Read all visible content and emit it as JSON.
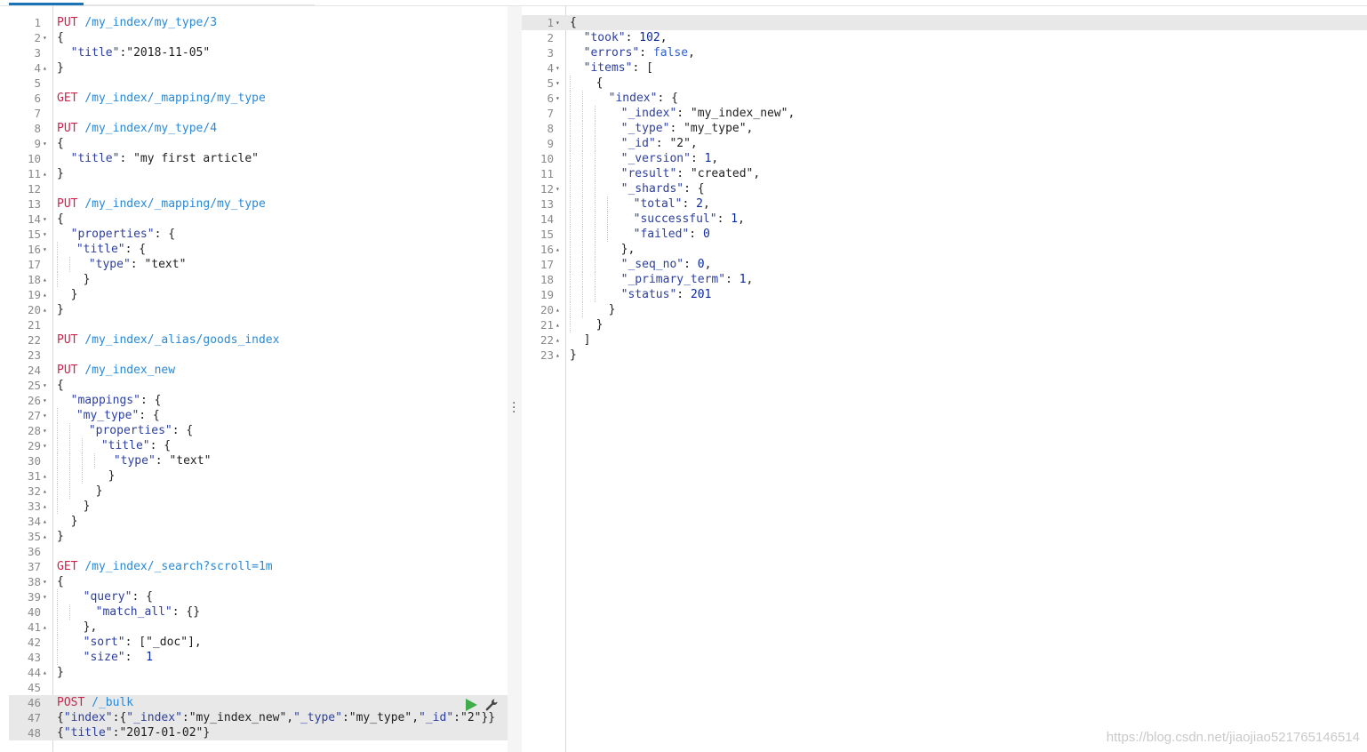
{
  "request_lines": [
    {
      "n": "1",
      "f": "",
      "p": [
        [
          "m",
          "PUT "
        ],
        [
          "u",
          "/my_index/my_type/3"
        ]
      ]
    },
    {
      "n": "2",
      "f": "▾",
      "p": [
        [
          "s",
          "{"
        ]
      ]
    },
    {
      "n": "3",
      "f": "",
      "p": [
        [
          "s",
          "  "
        ],
        [
          "k",
          "\"title\""
        ],
        [
          "s",
          ":\"2018-11-05\""
        ]
      ]
    },
    {
      "n": "4",
      "f": "▴",
      "p": [
        [
          "s",
          "}"
        ]
      ]
    },
    {
      "n": "5",
      "f": "",
      "p": []
    },
    {
      "n": "6",
      "f": "",
      "p": [
        [
          "m",
          "GET "
        ],
        [
          "u",
          "/my_index/_mapping/my_type"
        ]
      ]
    },
    {
      "n": "7",
      "f": "",
      "p": []
    },
    {
      "n": "8",
      "f": "",
      "p": [
        [
          "m",
          "PUT "
        ],
        [
          "u",
          "/my_index/my_type/4"
        ]
      ]
    },
    {
      "n": "9",
      "f": "▾",
      "p": [
        [
          "s",
          "{"
        ]
      ]
    },
    {
      "n": "10",
      "f": "",
      "p": [
        [
          "s",
          "  "
        ],
        [
          "k",
          "\"title\""
        ],
        [
          "s",
          ": \"my first article\""
        ]
      ]
    },
    {
      "n": "11",
      "f": "▴",
      "p": [
        [
          "s",
          "}"
        ]
      ]
    },
    {
      "n": "12",
      "f": "",
      "p": []
    },
    {
      "n": "13",
      "f": "",
      "p": [
        [
          "m",
          "PUT "
        ],
        [
          "u",
          "/my_index/_mapping/my_type"
        ]
      ]
    },
    {
      "n": "14",
      "f": "▾",
      "p": [
        [
          "s",
          "{"
        ]
      ]
    },
    {
      "n": "15",
      "f": "▾",
      "p": [
        [
          "s",
          "  "
        ],
        [
          "k",
          "\"properties\""
        ],
        [
          "s",
          ": {"
        ]
      ]
    },
    {
      "n": "16",
      "f": "▾",
      "p": [
        [
          "i",
          ""
        ],
        [
          "s",
          " "
        ],
        [
          "k",
          "\"title\""
        ],
        [
          "s",
          ": {"
        ]
      ]
    },
    {
      "n": "17",
      "f": "",
      "p": [
        [
          "i",
          ""
        ],
        [
          "i",
          ""
        ],
        [
          "s",
          " "
        ],
        [
          "k",
          "\"type\""
        ],
        [
          "s",
          ": \"text\""
        ]
      ]
    },
    {
      "n": "18",
      "f": "▴",
      "p": [
        [
          "i",
          ""
        ],
        [
          "s",
          "  }"
        ]
      ]
    },
    {
      "n": "19",
      "f": "▴",
      "p": [
        [
          "s",
          "  }"
        ]
      ]
    },
    {
      "n": "20",
      "f": "▴",
      "p": [
        [
          "s",
          "}"
        ]
      ]
    },
    {
      "n": "21",
      "f": "",
      "p": []
    },
    {
      "n": "22",
      "f": "",
      "p": [
        [
          "m",
          "PUT "
        ],
        [
          "u",
          "/my_index/_alias/goods_index"
        ]
      ]
    },
    {
      "n": "23",
      "f": "",
      "p": []
    },
    {
      "n": "24",
      "f": "",
      "p": [
        [
          "m",
          "PUT "
        ],
        [
          "u",
          "/my_index_new"
        ]
      ]
    },
    {
      "n": "25",
      "f": "▾",
      "p": [
        [
          "s",
          "{"
        ]
      ]
    },
    {
      "n": "26",
      "f": "▾",
      "p": [
        [
          "s",
          "  "
        ],
        [
          "k",
          "\"mappings\""
        ],
        [
          "s",
          ": {"
        ]
      ]
    },
    {
      "n": "27",
      "f": "▾",
      "p": [
        [
          "i",
          ""
        ],
        [
          "s",
          " "
        ],
        [
          "k",
          "\"my_type\""
        ],
        [
          "s",
          ": {"
        ]
      ]
    },
    {
      "n": "28",
      "f": "▾",
      "p": [
        [
          "i",
          ""
        ],
        [
          "i",
          ""
        ],
        [
          "s",
          " "
        ],
        [
          "k",
          "\"properties\""
        ],
        [
          "s",
          ": {"
        ]
      ]
    },
    {
      "n": "29",
      "f": "▾",
      "p": [
        [
          "i",
          ""
        ],
        [
          "i",
          ""
        ],
        [
          "i",
          ""
        ],
        [
          "s",
          " "
        ],
        [
          "k",
          "\"title\""
        ],
        [
          "s",
          ": {"
        ]
      ]
    },
    {
      "n": "30",
      "f": "",
      "p": [
        [
          "i",
          ""
        ],
        [
          "i",
          ""
        ],
        [
          "i",
          ""
        ],
        [
          "i",
          ""
        ],
        [
          "s",
          " "
        ],
        [
          "k",
          "\"type\""
        ],
        [
          "s",
          ": \"text\""
        ]
      ]
    },
    {
      "n": "31",
      "f": "▴",
      "p": [
        [
          "i",
          ""
        ],
        [
          "i",
          ""
        ],
        [
          "i",
          ""
        ],
        [
          "s",
          "  }"
        ]
      ]
    },
    {
      "n": "32",
      "f": "▴",
      "p": [
        [
          "i",
          ""
        ],
        [
          "i",
          ""
        ],
        [
          "s",
          "  }"
        ]
      ]
    },
    {
      "n": "33",
      "f": "▴",
      "p": [
        [
          "i",
          ""
        ],
        [
          "s",
          "  }"
        ]
      ]
    },
    {
      "n": "34",
      "f": "▴",
      "p": [
        [
          "s",
          "  }"
        ]
      ]
    },
    {
      "n": "35",
      "f": "▴",
      "p": [
        [
          "s",
          "}"
        ]
      ]
    },
    {
      "n": "36",
      "f": "",
      "p": []
    },
    {
      "n": "37",
      "f": "",
      "p": [
        [
          "m",
          "GET "
        ],
        [
          "u",
          "/my_index/_search?scroll=1m"
        ]
      ]
    },
    {
      "n": "38",
      "f": "▾",
      "p": [
        [
          "s",
          "{"
        ]
      ]
    },
    {
      "n": "39",
      "f": "▾",
      "p": [
        [
          "i",
          ""
        ],
        [
          "s",
          "  "
        ],
        [
          "k",
          "\"query\""
        ],
        [
          "s",
          ": {"
        ]
      ]
    },
    {
      "n": "40",
      "f": "",
      "p": [
        [
          "i",
          ""
        ],
        [
          "i",
          ""
        ],
        [
          "s",
          "  "
        ],
        [
          "k",
          "\"match_all\""
        ],
        [
          "s",
          ": {}"
        ]
      ]
    },
    {
      "n": "41",
      "f": "▴",
      "p": [
        [
          "i",
          ""
        ],
        [
          "s",
          "  },"
        ]
      ]
    },
    {
      "n": "42",
      "f": "",
      "p": [
        [
          "i",
          ""
        ],
        [
          "s",
          "  "
        ],
        [
          "k",
          "\"sort\""
        ],
        [
          "s",
          ": [\"_doc\"],"
        ]
      ]
    },
    {
      "n": "43",
      "f": "",
      "p": [
        [
          "i",
          ""
        ],
        [
          "s",
          "  "
        ],
        [
          "k",
          "\"size\""
        ],
        [
          "s",
          ":  "
        ],
        [
          "n",
          "1"
        ]
      ]
    },
    {
      "n": "44",
      "f": "▴",
      "p": [
        [
          "s",
          "}"
        ]
      ]
    },
    {
      "n": "45",
      "f": "",
      "p": []
    },
    {
      "n": "46",
      "f": "",
      "a": true,
      "p": [
        [
          "m",
          "POST "
        ],
        [
          "u",
          "/_bulk"
        ]
      ]
    },
    {
      "n": "47",
      "f": "",
      "a": true,
      "p": [
        [
          "s",
          "{"
        ],
        [
          "k",
          "\"index\""
        ],
        [
          "s",
          ":{"
        ],
        [
          "k",
          "\"_index\""
        ],
        [
          "s",
          ":\"my_index_new\","
        ],
        [
          "k",
          "\"_type\""
        ],
        [
          "s",
          ":\"my_type\","
        ],
        [
          "k",
          "\"_id\""
        ],
        [
          "s",
          ":\"2\"}}"
        ]
      ]
    },
    {
      "n": "48",
      "f": "",
      "a": true,
      "p": [
        [
          "s",
          "{"
        ],
        [
          "k",
          "\"title\""
        ],
        [
          "s",
          ":\"2017-01-02\"}"
        ]
      ]
    }
  ],
  "response_lines": [
    {
      "n": "1",
      "f": "▾",
      "a": true,
      "p": [
        [
          "s",
          "{"
        ]
      ]
    },
    {
      "n": "2",
      "f": "",
      "p": [
        [
          "s",
          "  "
        ],
        [
          "k",
          "\"took\""
        ],
        [
          "s",
          ": "
        ],
        [
          "n",
          "102"
        ],
        [
          "s",
          ","
        ]
      ]
    },
    {
      "n": "3",
      "f": "",
      "p": [
        [
          "s",
          "  "
        ],
        [
          "k",
          "\"errors\""
        ],
        [
          "s",
          ": "
        ],
        [
          "b",
          "false"
        ],
        [
          "s",
          ","
        ]
      ]
    },
    {
      "n": "4",
      "f": "▾",
      "p": [
        [
          "s",
          "  "
        ],
        [
          "k",
          "\"items\""
        ],
        [
          "s",
          ": ["
        ]
      ]
    },
    {
      "n": "5",
      "f": "▾",
      "p": [
        [
          "i",
          ""
        ],
        [
          "s",
          "  {"
        ]
      ]
    },
    {
      "n": "6",
      "f": "▾",
      "p": [
        [
          "i",
          ""
        ],
        [
          "i",
          ""
        ],
        [
          "s",
          "  "
        ],
        [
          "k",
          "\"index\""
        ],
        [
          "s",
          ": {"
        ]
      ]
    },
    {
      "n": "7",
      "f": "",
      "p": [
        [
          "i",
          ""
        ],
        [
          "i",
          ""
        ],
        [
          "i",
          ""
        ],
        [
          "s",
          "  "
        ],
        [
          "k",
          "\"_index\""
        ],
        [
          "s",
          ": \"my_index_new\","
        ]
      ]
    },
    {
      "n": "8",
      "f": "",
      "p": [
        [
          "i",
          ""
        ],
        [
          "i",
          ""
        ],
        [
          "i",
          ""
        ],
        [
          "s",
          "  "
        ],
        [
          "k",
          "\"_type\""
        ],
        [
          "s",
          ": \"my_type\","
        ]
      ]
    },
    {
      "n": "9",
      "f": "",
      "p": [
        [
          "i",
          ""
        ],
        [
          "i",
          ""
        ],
        [
          "i",
          ""
        ],
        [
          "s",
          "  "
        ],
        [
          "k",
          "\"_id\""
        ],
        [
          "s",
          ": \"2\","
        ]
      ]
    },
    {
      "n": "10",
      "f": "",
      "p": [
        [
          "i",
          ""
        ],
        [
          "i",
          ""
        ],
        [
          "i",
          ""
        ],
        [
          "s",
          "  "
        ],
        [
          "k",
          "\"_version\""
        ],
        [
          "s",
          ": "
        ],
        [
          "n",
          "1"
        ],
        [
          "s",
          ","
        ]
      ]
    },
    {
      "n": "11",
      "f": "",
      "p": [
        [
          "i",
          ""
        ],
        [
          "i",
          ""
        ],
        [
          "i",
          ""
        ],
        [
          "s",
          "  "
        ],
        [
          "k",
          "\"result\""
        ],
        [
          "s",
          ": \"created\","
        ]
      ]
    },
    {
      "n": "12",
      "f": "▾",
      "p": [
        [
          "i",
          ""
        ],
        [
          "i",
          ""
        ],
        [
          "i",
          ""
        ],
        [
          "s",
          "  "
        ],
        [
          "k",
          "\"_shards\""
        ],
        [
          "s",
          ": {"
        ]
      ]
    },
    {
      "n": "13",
      "f": "",
      "p": [
        [
          "i",
          ""
        ],
        [
          "i",
          ""
        ],
        [
          "i",
          ""
        ],
        [
          "i",
          ""
        ],
        [
          "s",
          "  "
        ],
        [
          "k",
          "\"total\""
        ],
        [
          "s",
          ": "
        ],
        [
          "n",
          "2"
        ],
        [
          "s",
          ","
        ]
      ]
    },
    {
      "n": "14",
      "f": "",
      "p": [
        [
          "i",
          ""
        ],
        [
          "i",
          ""
        ],
        [
          "i",
          ""
        ],
        [
          "i",
          ""
        ],
        [
          "s",
          "  "
        ],
        [
          "k",
          "\"successful\""
        ],
        [
          "s",
          ": "
        ],
        [
          "n",
          "1"
        ],
        [
          "s",
          ","
        ]
      ]
    },
    {
      "n": "15",
      "f": "",
      "p": [
        [
          "i",
          ""
        ],
        [
          "i",
          ""
        ],
        [
          "i",
          ""
        ],
        [
          "i",
          ""
        ],
        [
          "s",
          "  "
        ],
        [
          "k",
          "\"failed\""
        ],
        [
          "s",
          ": "
        ],
        [
          "n",
          "0"
        ]
      ]
    },
    {
      "n": "16",
      "f": "▴",
      "p": [
        [
          "i",
          ""
        ],
        [
          "i",
          ""
        ],
        [
          "i",
          ""
        ],
        [
          "s",
          "  },"
        ]
      ]
    },
    {
      "n": "17",
      "f": "",
      "p": [
        [
          "i",
          ""
        ],
        [
          "i",
          ""
        ],
        [
          "i",
          ""
        ],
        [
          "s",
          "  "
        ],
        [
          "k",
          "\"_seq_no\""
        ],
        [
          "s",
          ": "
        ],
        [
          "n",
          "0"
        ],
        [
          "s",
          ","
        ]
      ]
    },
    {
      "n": "18",
      "f": "",
      "p": [
        [
          "i",
          ""
        ],
        [
          "i",
          ""
        ],
        [
          "i",
          ""
        ],
        [
          "s",
          "  "
        ],
        [
          "k",
          "\"_primary_term\""
        ],
        [
          "s",
          ": "
        ],
        [
          "n",
          "1"
        ],
        [
          "s",
          ","
        ]
      ]
    },
    {
      "n": "19",
      "f": "",
      "p": [
        [
          "i",
          ""
        ],
        [
          "i",
          ""
        ],
        [
          "i",
          ""
        ],
        [
          "s",
          "  "
        ],
        [
          "k",
          "\"status\""
        ],
        [
          "s",
          ": "
        ],
        [
          "n",
          "201"
        ]
      ]
    },
    {
      "n": "20",
      "f": "▴",
      "p": [
        [
          "i",
          ""
        ],
        [
          "i",
          ""
        ],
        [
          "s",
          "  }"
        ]
      ]
    },
    {
      "n": "21",
      "f": "▴",
      "p": [
        [
          "i",
          ""
        ],
        [
          "s",
          "  }"
        ]
      ]
    },
    {
      "n": "22",
      "f": "▴",
      "p": [
        [
          "s",
          "  ]"
        ]
      ]
    },
    {
      "n": "23",
      "f": "▴",
      "p": [
        [
          "s",
          "}"
        ]
      ]
    }
  ],
  "watermark": "https://blog.csdn.net/jiaojiao521765146514",
  "icons": {
    "run": "play-icon",
    "settings": "wrench-icon",
    "splitter": "vertical-dots-icon"
  },
  "colors": {
    "method": "#c7254e",
    "url": "#2b89d6",
    "key": "#2d3f9e",
    "number": "#0b2a9b",
    "run": "#3fae4a",
    "active_line": "#e8e8e8"
  }
}
